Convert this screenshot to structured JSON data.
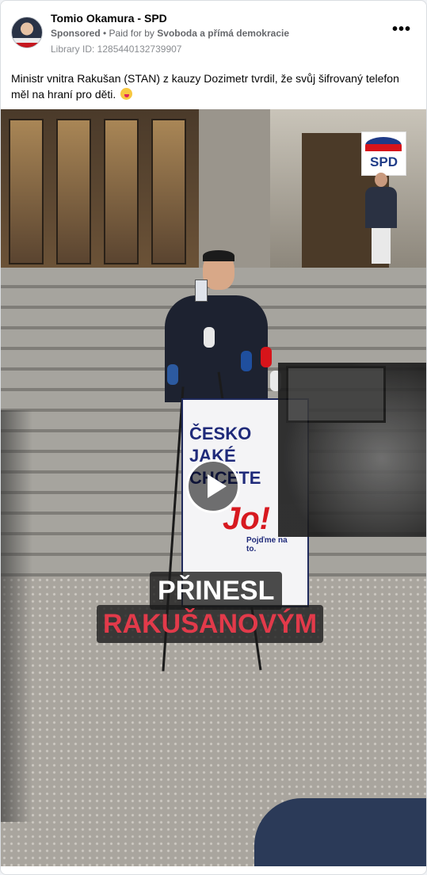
{
  "ad": {
    "page_name": "Tomio Okamura - SPD",
    "sponsored": "Sponsored",
    "paid_for_prefix": "• Paid for by",
    "payer": "Svoboda a přímá demokracie",
    "library_id": "Library ID: 1285440132739907",
    "more_icon": "more-options-icon",
    "post_text": "Ministr vnitra Rakušan (STAN) z kauzy Dozimetr tvrdil, že svůj šifrovaný telefon měl na hraní pro děti.",
    "post_emoji": "tongue-out-emoji"
  },
  "video": {
    "play_icon": "play-icon",
    "caption_line1": "PŘINESL",
    "caption_line2": "RAKUŠANOVÝM",
    "sign": {
      "line1": "ČESKO",
      "line2": "JAKÉ",
      "line3": "CHCETE",
      "slogan": "Jo!",
      "tagline": "Pojďme na to."
    },
    "logo_text": "SPD",
    "colors": {
      "caption_red": "#e23a4a",
      "caption_bg": "#191919",
      "sign_blue": "#1f2a7a",
      "sign_red": "#d71920"
    }
  }
}
